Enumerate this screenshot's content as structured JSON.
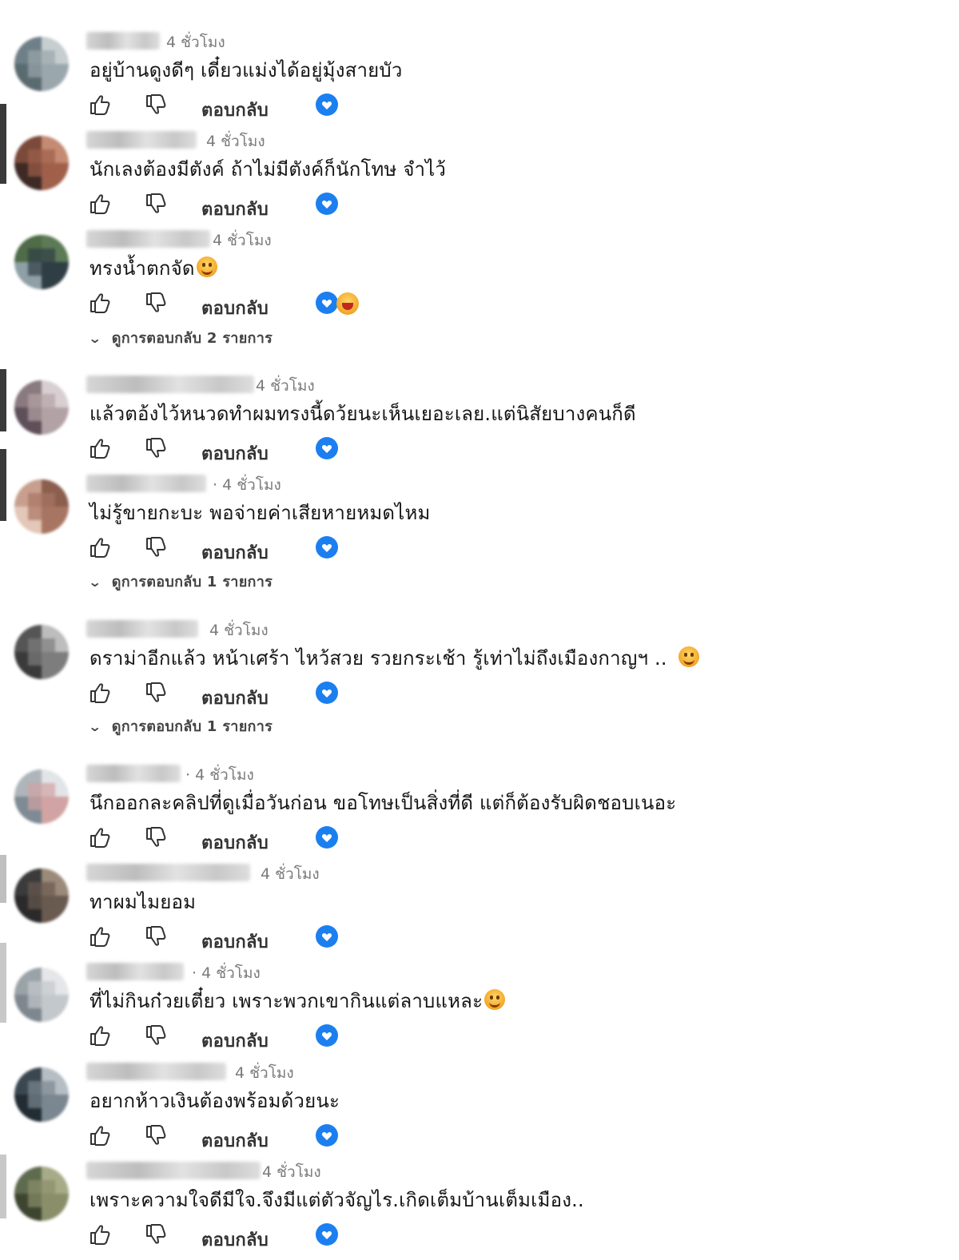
{
  "ui": {
    "reply_label": "ตอบกลับ",
    "like_icon": "thumbs-up-icon",
    "dislike_icon": "thumbs-down-icon",
    "creator_heart_icon": "creator-heart-icon",
    "accent": "#1c7ff0"
  },
  "comments": [
    {
      "time": "4 ชั่วโมง",
      "text": "อยู่บ้านดูงดีๆ เดี๋ยวแม่งได้อยู่มุ้งสายบัว",
      "emoji": false
    },
    {
      "time": "4 ชั่วโมง",
      "text": "นักเลงต้องมีตังค์ ถ้าไม่มีตังค์ก็นักโทษ จำไว้",
      "emoji": false
    },
    {
      "time": "4 ชั่วโมง",
      "text": "ทรงน้ำตกจัด",
      "emoji": true,
      "reaction_emoji": true,
      "replies": "ดูการตอบกลับ 2 รายการ"
    },
    {
      "time": "4 ชั่วโมง",
      "text": "แล้วตอ้งไว้หนวดทำผมทรงนี้ดว้ยนะเห็นเยอะเลย.แต่นิสัยบางคนก็ดี",
      "emoji": false
    },
    {
      "time": "· 4 ชั่วโมง",
      "text": "ไม่รู้ขายกะบะ พอจ่ายค่าเสียหายหมดไหม",
      "emoji": false,
      "replies": "ดูการตอบกลับ 1 รายการ"
    },
    {
      "time": "4 ชั่วโมง",
      "text": "ดราม่าอีกแล้ว หน้าเศร้า ไหว้สวย รวยกระเช้า รู้เท่าไม่ถึงเมืองกาญฯ ..",
      "emoji": true,
      "replies": "ดูการตอบกลับ 1 รายการ"
    },
    {
      "time": "· 4 ชั่วโมง",
      "text": "นึกออกละคลิปที่ดูเมื่อวันก่อน ขอโทษเป็นสิ่งที่ดี แต่ก็ต้องรับผิดชอบเนอะ",
      "emoji": false
    },
    {
      "time": "4 ชั่วโมง",
      "text": "ทาผมไมยอม",
      "emoji": false
    },
    {
      "time": "· 4 ชั่วโมง",
      "text": "ที่ไม่กินก๋วยเตี๋ยว เพราะพวกเขากินแต่ลาบแหละ",
      "emoji": true
    },
    {
      "time": "4 ชั่วโมง",
      "text": "อยากห้าวเงินต้องพร้อมด้วยนะ",
      "emoji": false
    },
    {
      "time": "4 ชั่วโมง",
      "text": "เพราะความใจดีมีใจ.จึงมีแต่ตัวจัญไร.เกิดเต็มบ้านเต็มเมือง..",
      "emoji": false
    }
  ]
}
